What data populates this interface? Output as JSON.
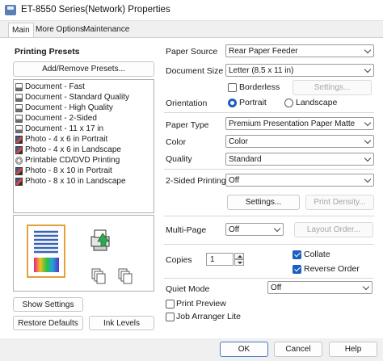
{
  "window": {
    "title": "ET-8550 Series(Network) Properties"
  },
  "tabs": [
    {
      "label": "Main",
      "active": true
    },
    {
      "label": "More Options",
      "active": false
    },
    {
      "label": "Maintenance",
      "active": false
    }
  ],
  "left": {
    "presets_title": "Printing Presets",
    "add_remove_label": "Add/Remove Presets...",
    "presets": [
      {
        "label": "Document - Fast",
        "icon": "document-icon"
      },
      {
        "label": "Document - Standard Quality",
        "icon": "document-icon"
      },
      {
        "label": "Document - High Quality",
        "icon": "document-icon"
      },
      {
        "label": "Document - 2-Sided",
        "icon": "document-icon"
      },
      {
        "label": "Document - 11 x 17 in",
        "icon": "document-icon"
      },
      {
        "label": "Photo - 4 x 6 in Portrait",
        "icon": "photo-icon"
      },
      {
        "label": "Photo - 4 x 6 in Landscape",
        "icon": "photo-icon"
      },
      {
        "label": "Printable CD/DVD Printing",
        "icon": "disc-icon"
      },
      {
        "label": "Photo - 8 x 10 in Portrait",
        "icon": "photo-icon"
      },
      {
        "label": "Photo - 8 x 10 in Landscape",
        "icon": "photo-icon"
      }
    ],
    "show_settings_label": "Show Settings",
    "restore_defaults_label": "Restore Defaults",
    "ink_levels_label": "Ink Levels"
  },
  "right": {
    "paper_source": {
      "label": "Paper Source",
      "value": "Rear Paper Feeder"
    },
    "document_size": {
      "label": "Document Size",
      "value": "Letter (8.5 x 11 in)"
    },
    "borderless": {
      "label": "Borderless",
      "checked": false
    },
    "borderless_settings_label": "Settings...",
    "orientation": {
      "label": "Orientation",
      "portrait": "Portrait",
      "landscape": "Landscape",
      "selected": "Portrait"
    },
    "paper_type": {
      "label": "Paper Type",
      "value": "Premium Presentation Paper Matte"
    },
    "color": {
      "label": "Color",
      "value": "Color"
    },
    "quality": {
      "label": "Quality",
      "value": "Standard"
    },
    "two_sided": {
      "label": "2-Sided Printing",
      "value": "Off"
    },
    "two_sided_settings_label": "Settings...",
    "print_density_label": "Print Density...",
    "multi_page": {
      "label": "Multi-Page",
      "value": "Off"
    },
    "layout_order_label": "Layout Order...",
    "copies": {
      "label": "Copies",
      "value": "1"
    },
    "collate": {
      "label": "Collate",
      "checked": true
    },
    "reverse_order": {
      "label": "Reverse Order",
      "checked": true
    },
    "quiet_mode": {
      "label": "Quiet Mode",
      "value": "Off"
    },
    "print_preview": {
      "label": "Print Preview",
      "checked": false
    },
    "job_arranger": {
      "label": "Job Arranger Lite",
      "checked": false
    }
  },
  "footer": {
    "ok_label": "OK",
    "cancel_label": "Cancel",
    "help_label": "Help"
  },
  "colors": {
    "accent": "#1b5fc0",
    "panel": "#ffffff",
    "chrome": "#f0f0f0"
  }
}
